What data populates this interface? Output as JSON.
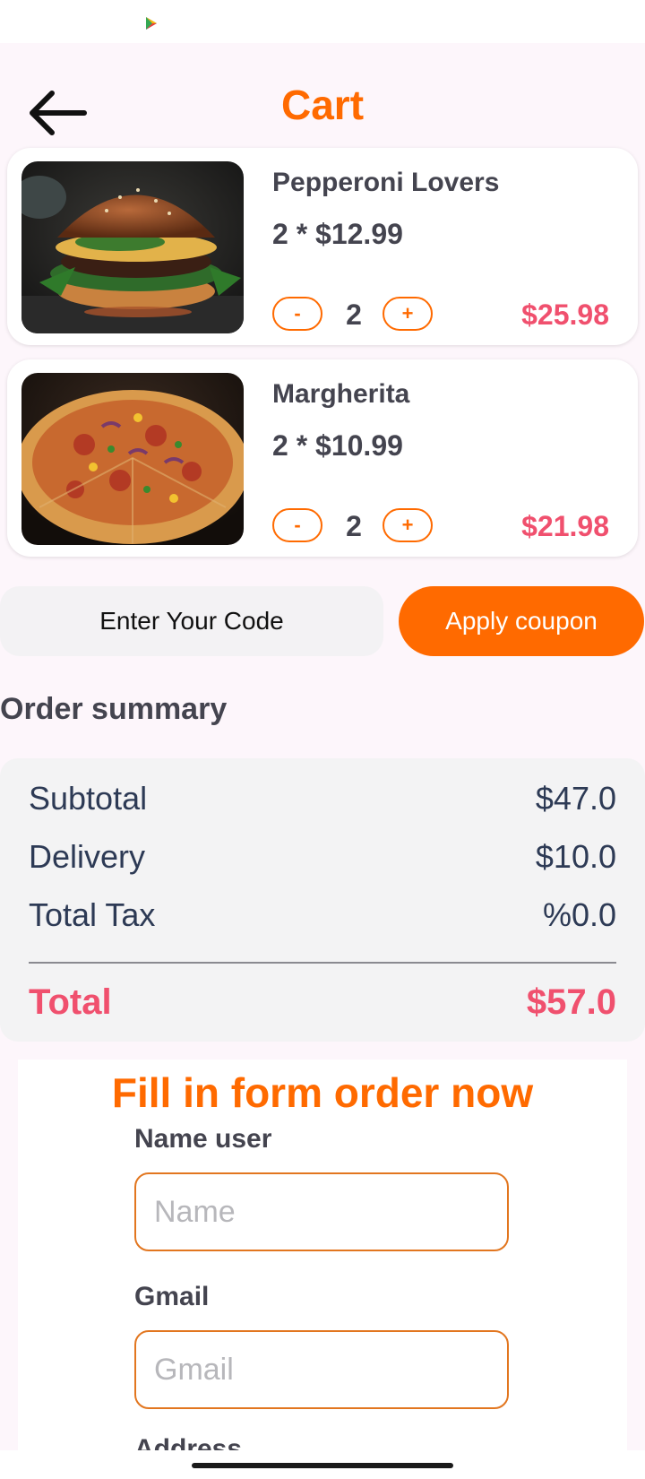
{
  "status_bar": {
    "icons": [
      "play-store-icon"
    ]
  },
  "header": {
    "title": "Cart",
    "back_icon": "arrow-left-icon"
  },
  "cart": {
    "items": [
      {
        "name": "Pepperoni Lovers",
        "price_line": "2 * $12.99",
        "minus_label": "-",
        "quantity": "2",
        "plus_label": "+",
        "line_total": "$25.98",
        "image": "burger-photo"
      },
      {
        "name": "Margherita",
        "price_line": "2 * $10.99",
        "minus_label": "-",
        "quantity": "2",
        "plus_label": "+",
        "line_total": "$21.98",
        "image": "pizza-photo"
      }
    ]
  },
  "coupon": {
    "placeholder": "Enter Your Code",
    "apply_label": "Apply coupon"
  },
  "summary": {
    "title": "Order summary",
    "subtotal_label": "Subtotal",
    "subtotal_value": "$47.0",
    "delivery_label": "Delivery",
    "delivery_value": "$10.0",
    "tax_label": "Total Tax",
    "tax_value": "%0.0",
    "total_label": "Total",
    "total_value": "$57.0"
  },
  "form": {
    "title": "Fill in form order now",
    "name_label": "Name user",
    "name_placeholder": "Name",
    "gmail_label": "Gmail",
    "gmail_placeholder": "Gmail",
    "address_label": "Address"
  },
  "colors": {
    "accent": "#ff6a00",
    "price": "#f0506e",
    "background": "#fdf6fb"
  }
}
